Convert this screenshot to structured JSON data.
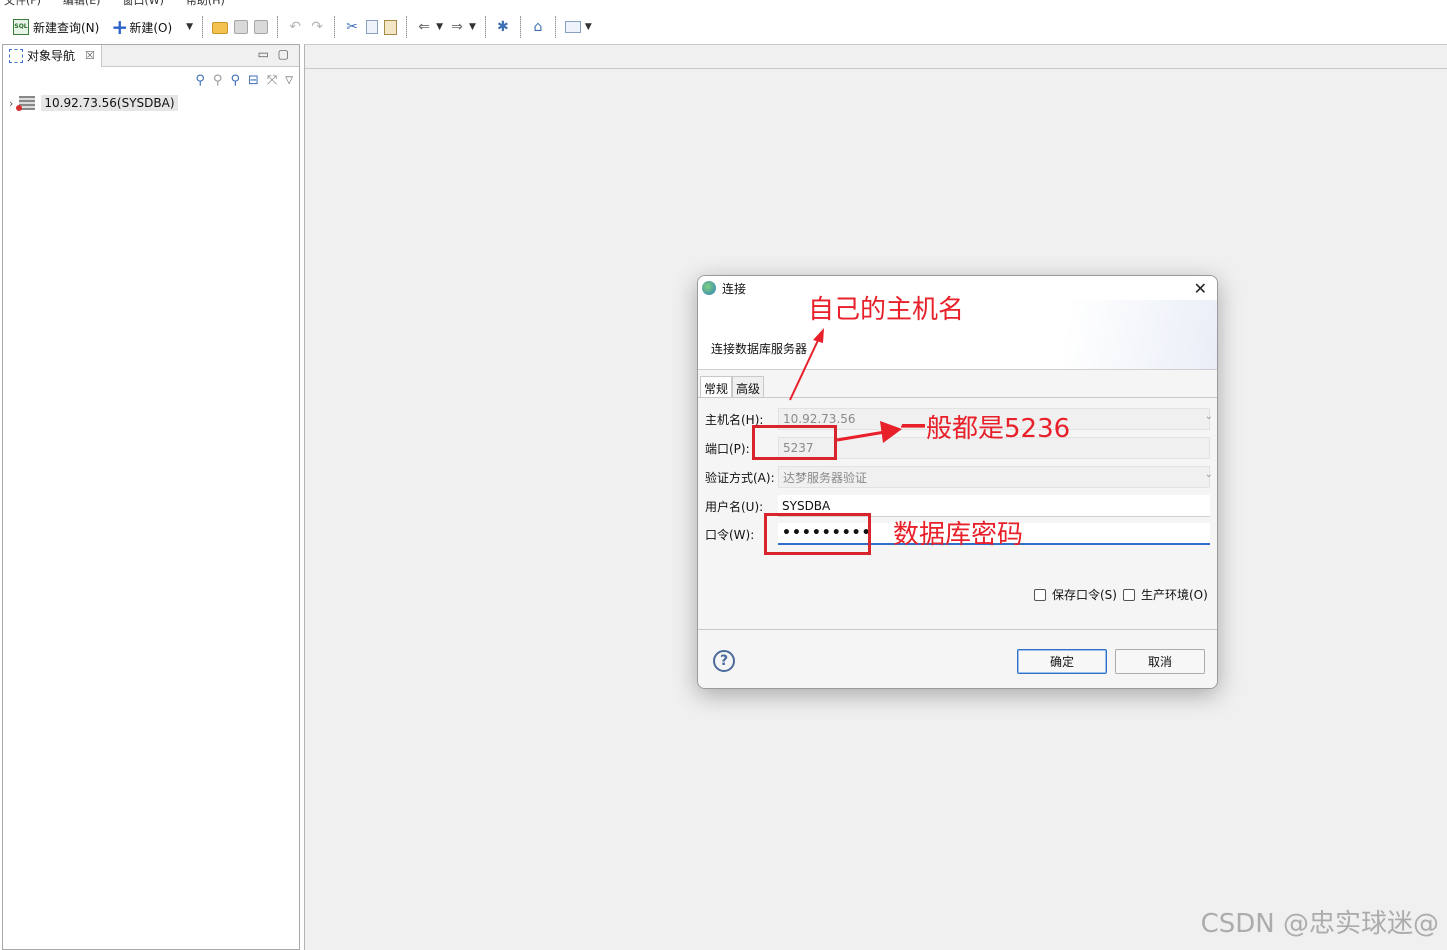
{
  "menubar": {
    "items": [
      "文件(F)",
      "编辑(E)",
      "窗口(W)",
      "帮助(H)"
    ]
  },
  "toolbar": {
    "new_query": "新建查询(N)",
    "new": "新建(O)"
  },
  "left_panel": {
    "tab_label": "对象导航",
    "tree": [
      {
        "label": "10.92.73.56(SYSDBA)"
      }
    ]
  },
  "dialog": {
    "title": "连接",
    "header": "连接数据库服务器",
    "tabs": [
      "常规",
      "高级"
    ],
    "fields": {
      "host": {
        "label": "主机名(H):",
        "value": "10.92.73.56"
      },
      "port": {
        "label": "端口(P):",
        "value": "5237"
      },
      "auth": {
        "label": "验证方式(A):",
        "value": "达梦服务器验证"
      },
      "user": {
        "label": "用户名(U):",
        "value": "SYSDBA"
      },
      "password": {
        "label": "口令(W):",
        "value": "•••••••••"
      }
    },
    "checkboxes": {
      "save_password": "保存口令(S)",
      "production": "生产环境(O)"
    },
    "buttons": {
      "ok": "确定",
      "cancel": "取消"
    },
    "help_symbol": "?"
  },
  "annotations": {
    "host_note": "自己的主机名",
    "port_note": "一般都是5236",
    "password_note": "数据库密码",
    "color": "#e8202a"
  },
  "watermark": "CSDN @忠实球迷@"
}
